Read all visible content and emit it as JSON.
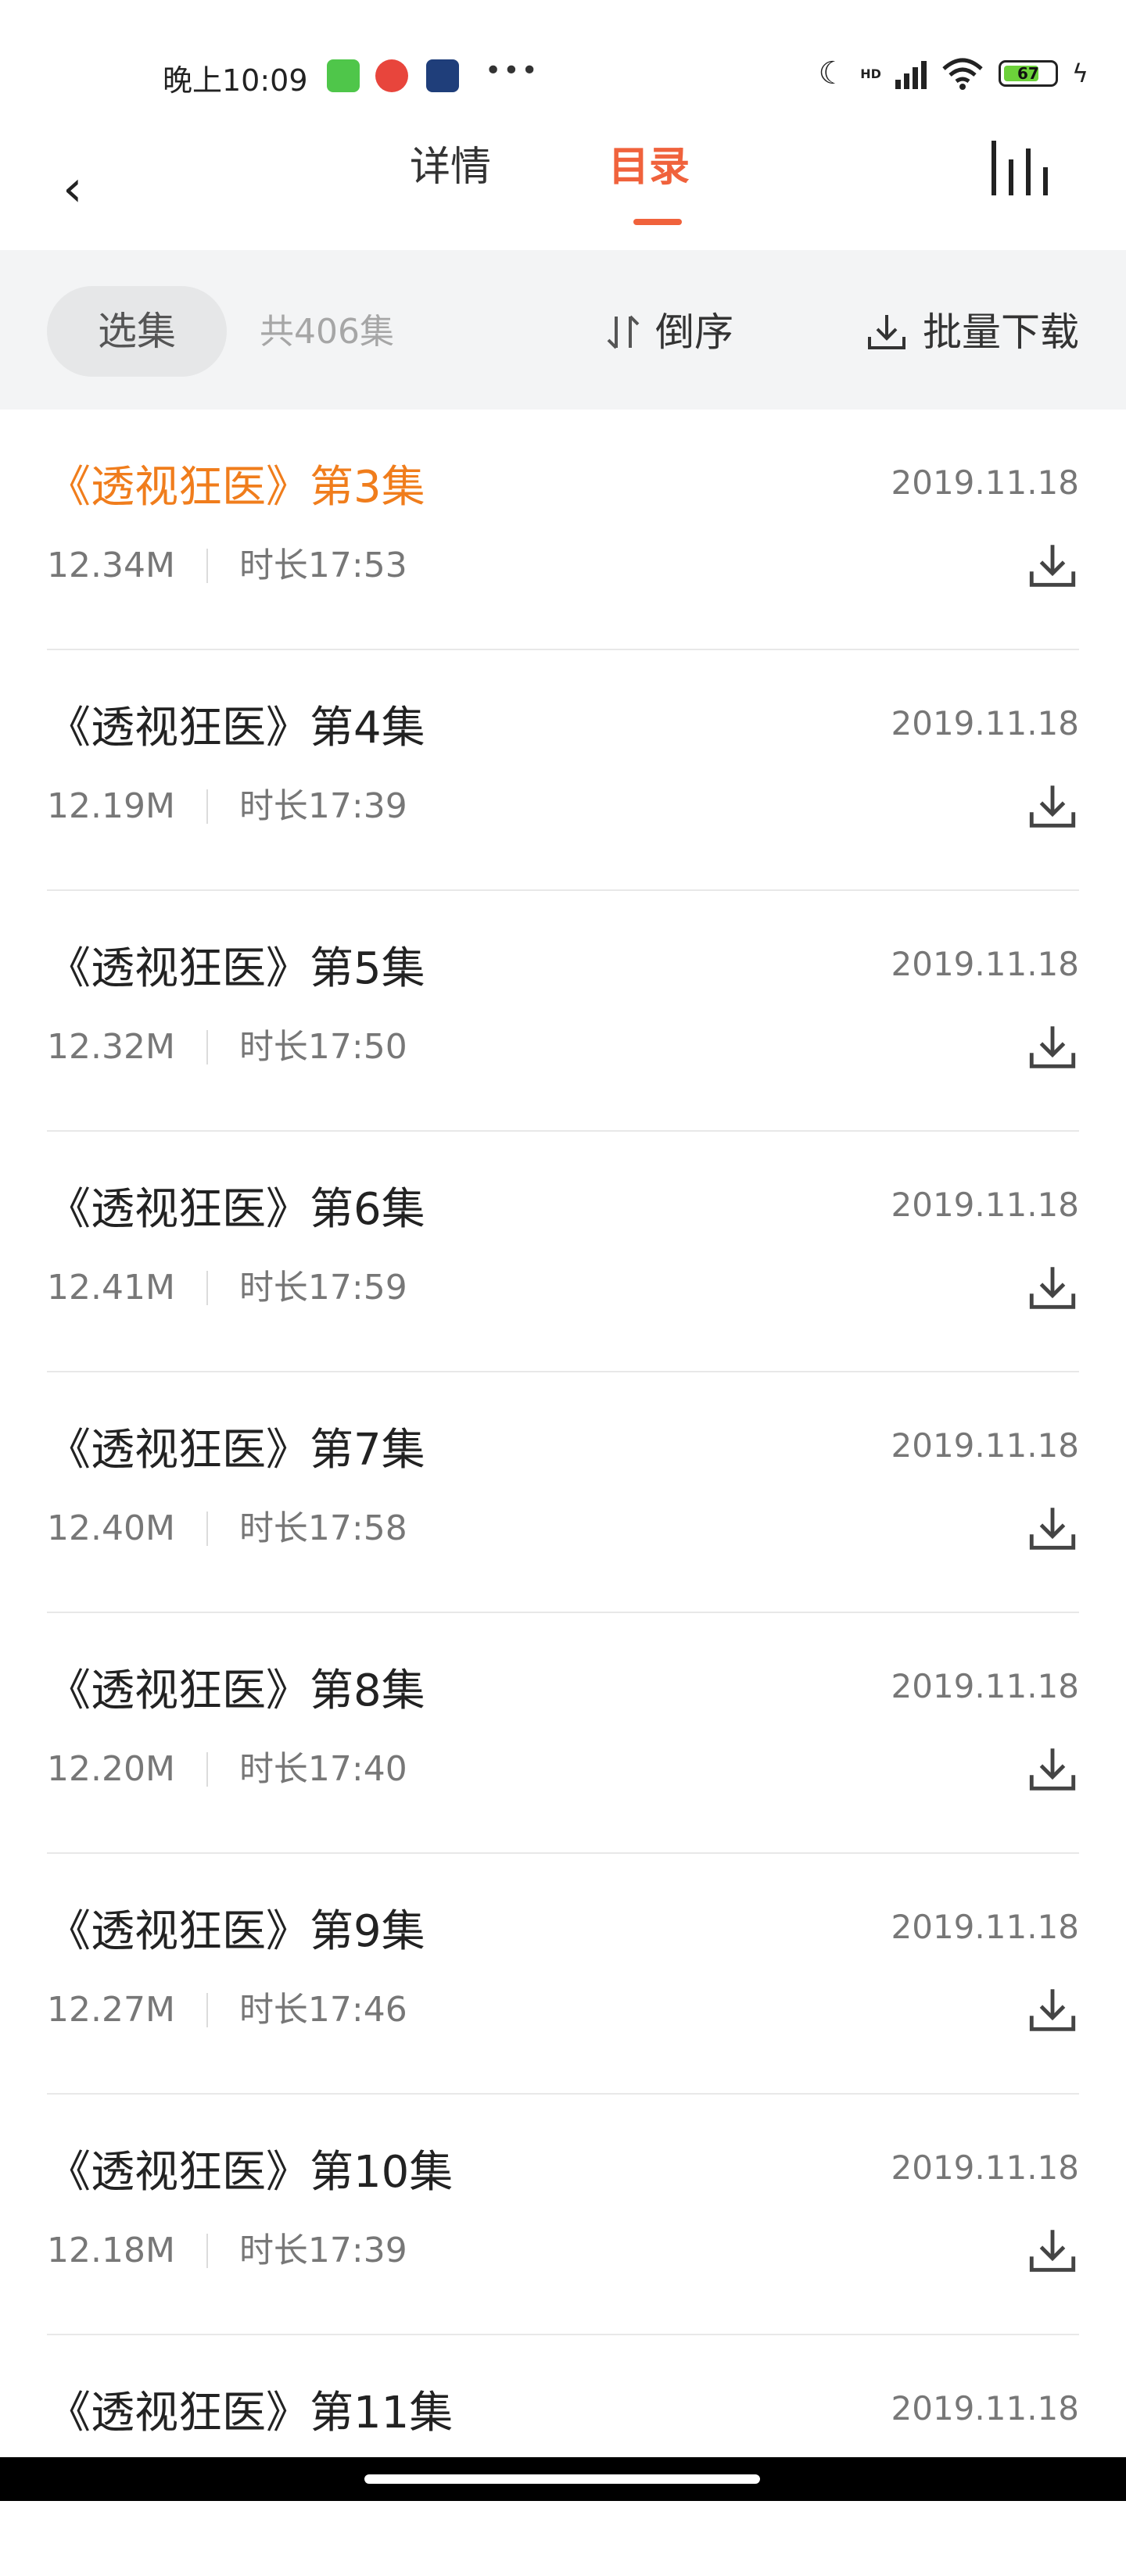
{
  "status_bar": {
    "time": "晚上10:09",
    "network": "HD",
    "battery": "67"
  },
  "header": {
    "tab_detail": "详情",
    "tab_catalog": "目录",
    "active_tab": "目录",
    "accent_color": "#f0623c"
  },
  "toolbar": {
    "select_label": "选集",
    "count_label": "共406集",
    "sort_label": "倒序",
    "batch_download_label": "批量下载"
  },
  "episodes": [
    {
      "title": "《透视狂医》第3集",
      "date": "2019.11.18",
      "size": "12.34M",
      "duration": "时长17:53",
      "current": true
    },
    {
      "title": "《透视狂医》第4集",
      "date": "2019.11.18",
      "size": "12.19M",
      "duration": "时长17:39"
    },
    {
      "title": "《透视狂医》第5集",
      "date": "2019.11.18",
      "size": "12.32M",
      "duration": "时长17:50"
    },
    {
      "title": "《透视狂医》第6集",
      "date": "2019.11.18",
      "size": "12.41M",
      "duration": "时长17:59"
    },
    {
      "title": "《透视狂医》第7集",
      "date": "2019.11.18",
      "size": "12.40M",
      "duration": "时长17:58"
    },
    {
      "title": "《透视狂医》第8集",
      "date": "2019.11.18",
      "size": "12.20M",
      "duration": "时长17:40"
    },
    {
      "title": "《透视狂医》第9集",
      "date": "2019.11.18",
      "size": "12.27M",
      "duration": "时长17:46"
    },
    {
      "title": "《透视狂医》第10集",
      "date": "2019.11.18",
      "size": "12.18M",
      "duration": "时长17:39"
    },
    {
      "title": "《透视狂医》第11集",
      "date": "2019.11.18"
    }
  ],
  "icons": {
    "back": "chevron-left-icon",
    "chart": "bar-chart-icon",
    "sort": "sort-arrows-icon",
    "download": "download-icon"
  },
  "colors": {
    "current_episode": "#f07d1c",
    "toolbar_bg": "#f3f4f5"
  }
}
